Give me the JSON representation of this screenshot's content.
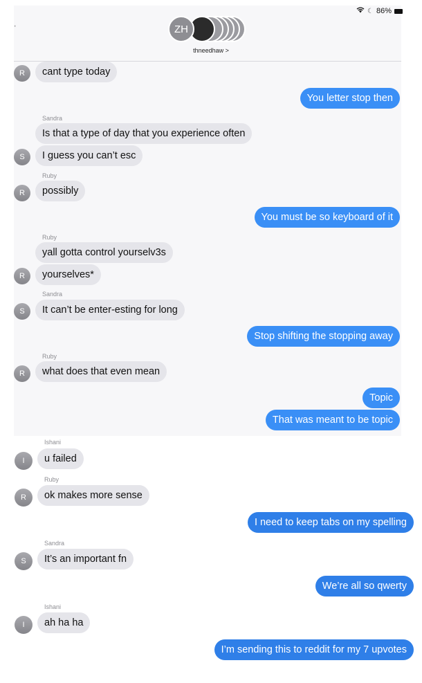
{
  "status": {
    "battery": "86%",
    "left_char": "ˈ"
  },
  "header": {
    "avatar_initials": "ZH",
    "group_name": "thneedhaw >"
  },
  "messages": [
    {
      "sender": "",
      "avatar": "R",
      "text": "cant type today"
    },
    {
      "sender": "",
      "avatar": "",
      "text": "You letter stop then"
    },
    {
      "sender": "Sandra",
      "avatar": "",
      "text": "Is that a type of day that you experience often"
    },
    {
      "sender": "",
      "avatar": "S",
      "text": "I guess you can’t esc"
    },
    {
      "sender": "Ruby",
      "avatar": "R",
      "text": "possibly"
    },
    {
      "sender": "",
      "avatar": "",
      "text": "You must be so keyboard of it"
    },
    {
      "sender": "Ruby",
      "avatar": "",
      "text": "yall gotta control yourselv3s"
    },
    {
      "sender": "",
      "avatar": "R",
      "text": "yourselves*"
    },
    {
      "sender": "Sandra",
      "avatar": "S",
      "text": "It can’t be enter-esting for long"
    },
    {
      "sender": "",
      "avatar": "",
      "text": "Stop shifting the stopping away"
    },
    {
      "sender": "Ruby",
      "avatar": "R",
      "text": "what does that even mean"
    },
    {
      "sender": "",
      "avatar": "",
      "text": "Topic"
    },
    {
      "sender": "",
      "avatar": "",
      "text": "That was meant to be topic"
    },
    {
      "sender": "Ishani",
      "avatar": "I",
      "text": "u failed"
    },
    {
      "sender": "Ruby",
      "avatar": "R",
      "text": "ok makes more sense"
    },
    {
      "sender": "",
      "avatar": "",
      "text": "I need to keep tabs on my spelling"
    },
    {
      "sender": "Sandra",
      "avatar": "S",
      "text": "It’s an important fn"
    },
    {
      "sender": "",
      "avatar": "",
      "text": "We’re all so qwerty"
    },
    {
      "sender": "Ishani",
      "avatar": "I",
      "text": "ah ha ha"
    },
    {
      "sender": "",
      "avatar": "",
      "text": "I’m sending this to reddit for my 7 upvotes"
    }
  ]
}
